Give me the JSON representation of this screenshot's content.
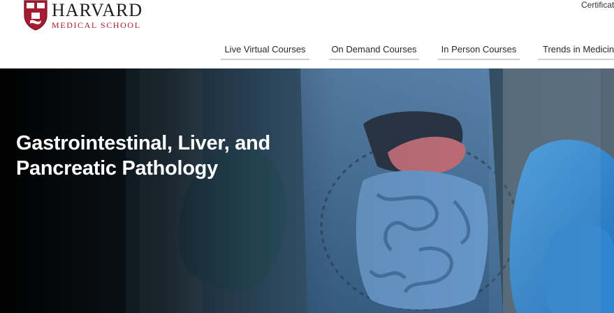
{
  "brand": {
    "name": "HARVARD",
    "subtitle": "MEDICAL SCHOOL",
    "accent": "#a51c30"
  },
  "top_links": {
    "certificates": "Certificat"
  },
  "nav": {
    "items": [
      {
        "label": "Live Virtual Courses"
      },
      {
        "label": "On Demand Courses"
      },
      {
        "label": "In Person Courses"
      },
      {
        "label": "Trends in Medicine"
      }
    ]
  },
  "hero": {
    "title_line1": "Gastrointestinal, Liver, and",
    "title_line2": "Pancreatic Pathology",
    "image": "gloved-hands-holding-glass-gi-anatomy-model"
  }
}
